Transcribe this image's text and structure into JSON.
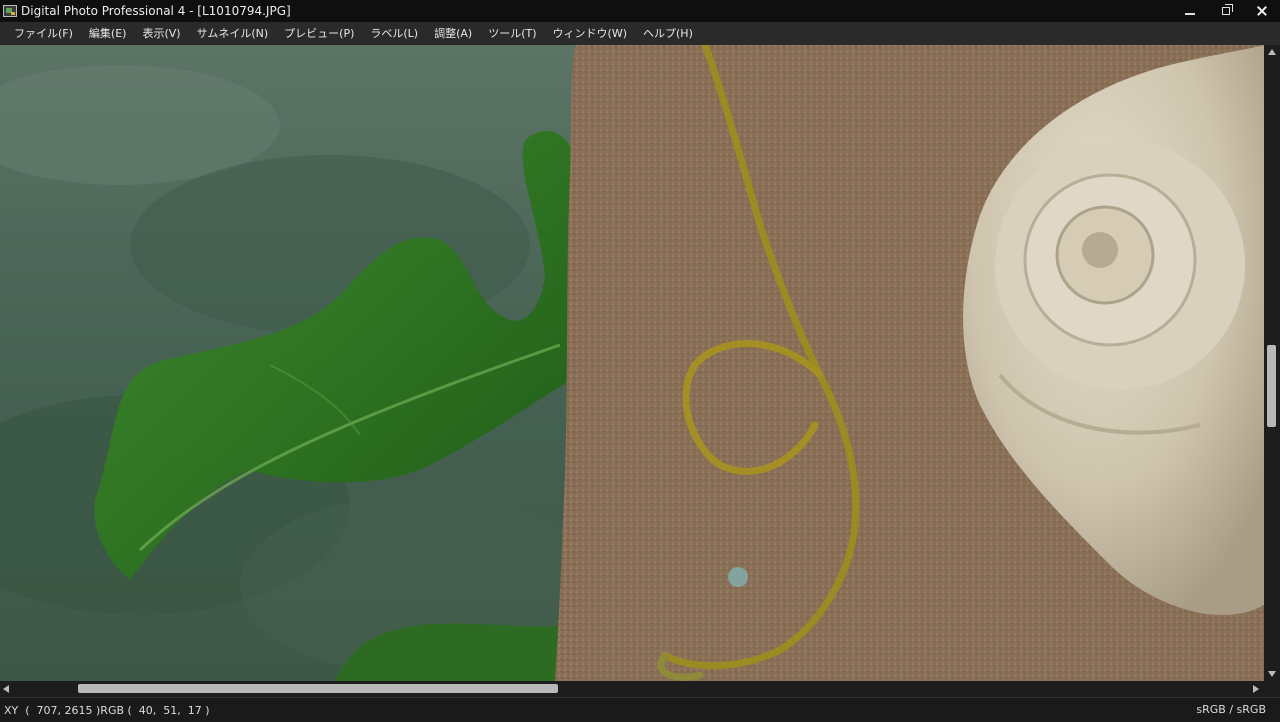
{
  "window": {
    "title": "Digital Photo Professional 4 - [L1010794.JPG]"
  },
  "menu": [
    {
      "label": "ファイル(F)"
    },
    {
      "label": "編集(E)"
    },
    {
      "label": "表示(V)"
    },
    {
      "label": "サムネイル(N)"
    },
    {
      "label": "プレビュー(P)"
    },
    {
      "label": "ラベル(L)"
    },
    {
      "label": "調整(A)"
    },
    {
      "label": "ツール(T)"
    },
    {
      "label": "ウィンドウ(W)"
    },
    {
      "label": "ヘルプ(H)"
    }
  ],
  "status": {
    "xy_rgb": "XY  (  707, 2615 )RGB (  40,  51,  17 )",
    "color_profile": "sRGB / sRGB"
  },
  "colors": {
    "titlebar_bg": "#0f0f0f",
    "menubar_bg": "#2a2a2a",
    "statusbar_bg": "#1a1a1a"
  },
  "icons": {
    "app": "app-icon",
    "minimize": "minimize-icon",
    "maximize": "restore-icon",
    "close": "close-icon"
  }
}
